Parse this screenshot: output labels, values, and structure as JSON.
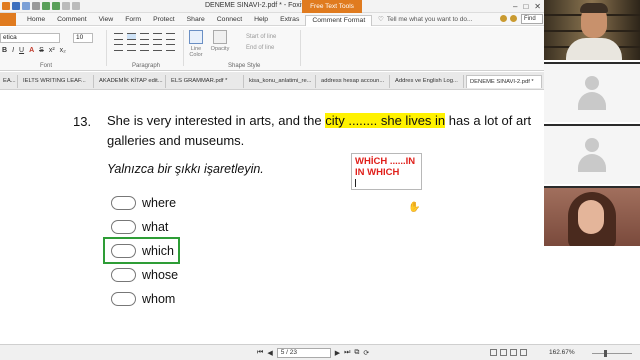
{
  "window": {
    "title": "DENEME SINAVI-2.pdf * - Foxit Reader",
    "context_tab": "Free Text Tools"
  },
  "menu": {
    "items": [
      "Home",
      "Comment",
      "View",
      "Form",
      "Protect",
      "Share",
      "Connect",
      "Help",
      "Extras",
      "Comment Format"
    ],
    "active": "Comment Format",
    "tell_me": "Tell me what you want to do...",
    "find_placeholder": "Find"
  },
  "ribbon": {
    "font_name": "etica",
    "font_size": "10",
    "group_font": "Font",
    "group_paragraph": "Paragraph",
    "group_shape_style": "Shape Style",
    "line_color": "Line Color",
    "opacity": "Opacity",
    "start_of_line": "Start of line",
    "end_of_line": "End of line"
  },
  "tabs": [
    "EA...",
    "IELTS WRITING LEAF...",
    "AKADEMİK KİTAP edit...",
    "ELS GRAMMAR.pdf *",
    "kisa_konu_anlatimi_re...",
    "address hesap accoun...",
    "Addres ve English Log...",
    "DENEME SINAVI-2.pdf *"
  ],
  "document": {
    "question_number": "13.",
    "q_part1": "She is very interested in arts, and the ",
    "q_highlight1": "city ........ she lives in",
    "q_part2": " has a lot of art galleries and museums.",
    "instruction": "Yalnızca bir şıkkı işaretleyin.",
    "note_line1": "WHİCH ......IN",
    "note_line2": "IN WHICH",
    "options": [
      "where",
      "what",
      "which",
      "whose",
      "whom"
    ],
    "correct_option": "which"
  },
  "statusbar": {
    "page": "5 / 23",
    "zoom": "162.67%"
  },
  "colors": {
    "highlight": "#fff200",
    "note_text": "#e0201b",
    "correct_box": "#2e9d36",
    "accent": "#e07b1f"
  }
}
